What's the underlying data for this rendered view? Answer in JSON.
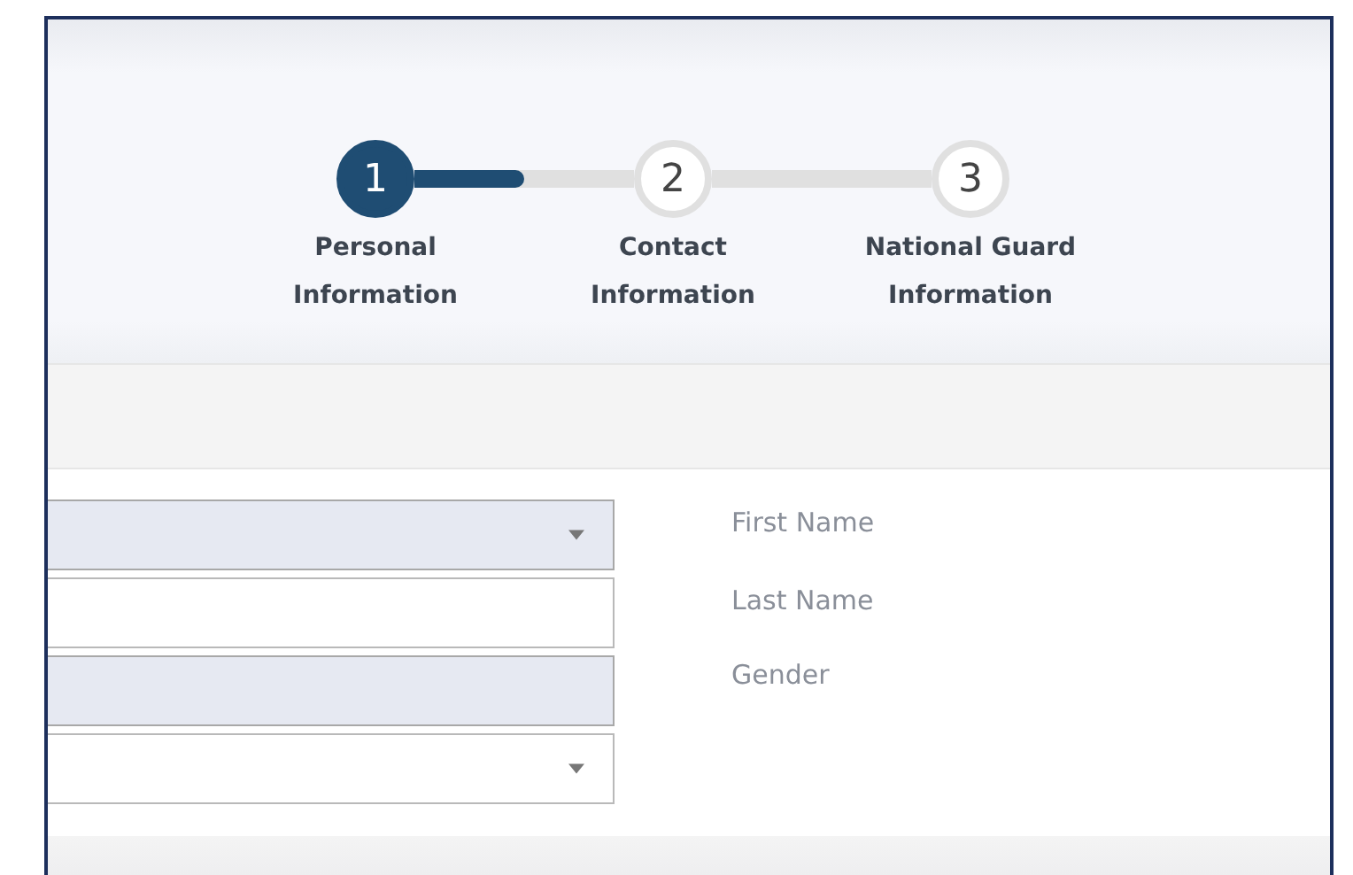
{
  "steps": [
    {
      "number": "1",
      "label": "Personal Information",
      "selected": true
    },
    {
      "number": "2",
      "label": "Contact Information",
      "selected": false
    },
    {
      "number": "3",
      "label": "National Guard Information",
      "selected": false
    }
  ],
  "progress": {
    "level": 0.5
  },
  "fields": [
    {
      "kind": "dropdown",
      "disabled": true
    },
    {
      "kind": "text",
      "disabled": false
    },
    {
      "kind": "text",
      "disabled": true
    },
    {
      "kind": "dropdown",
      "disabled": false
    }
  ],
  "labels": [
    "First Name",
    "Last Name",
    "Gender"
  ]
}
